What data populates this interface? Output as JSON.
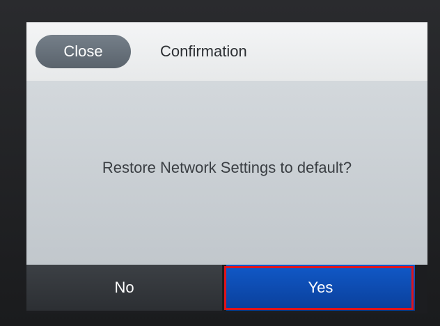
{
  "header": {
    "close_label": "Close",
    "title": "Confirmation"
  },
  "dialog": {
    "message": "Restore Network Settings to default?"
  },
  "footer": {
    "no_label": "No",
    "yes_label": "Yes"
  },
  "colors": {
    "accent": "#0a3f9a",
    "highlight": "#e0141b"
  }
}
